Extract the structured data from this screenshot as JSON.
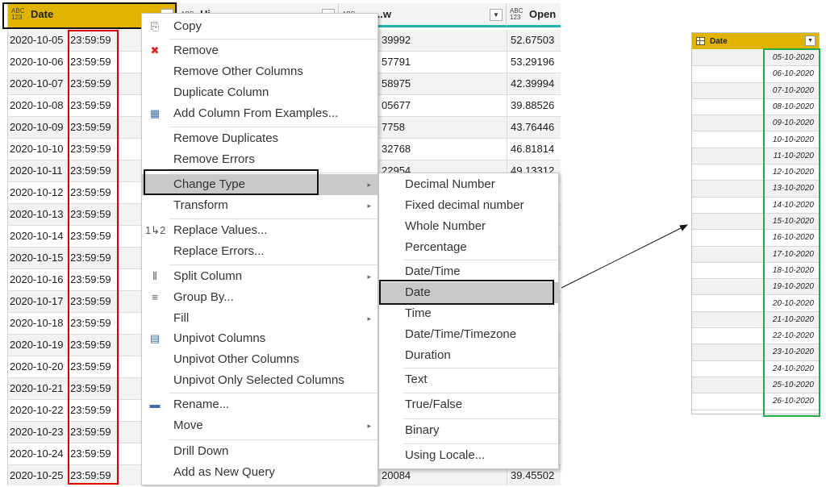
{
  "grid": {
    "columns": [
      {
        "type_icon": "ABC\n123",
        "label": "Date"
      },
      {
        "type_icon": "ABC",
        "label": "Hi..."
      },
      {
        "type_icon": "ABC",
        "label": "...w"
      },
      {
        "type_icon": "ABC\n123",
        "label": "Open"
      }
    ],
    "rows": [
      {
        "date": "2020-10-05",
        "time": "23:59:59",
        "low": "39992",
        "open": "52.67503"
      },
      {
        "date": "2020-10-06",
        "time": "23:59:59",
        "low": "57791",
        "open": "53.29196"
      },
      {
        "date": "2020-10-07",
        "time": "23:59:59",
        "low": "58975",
        "open": "42.39994"
      },
      {
        "date": "2020-10-08",
        "time": "23:59:59",
        "low": "05677",
        "open": "39.88526"
      },
      {
        "date": "2020-10-09",
        "time": "23:59:59",
        "low": "7758",
        "open": "43.76446"
      },
      {
        "date": "2020-10-10",
        "time": "23:59:59",
        "low": "32768",
        "open": "46.81814"
      },
      {
        "date": "2020-10-11",
        "time": "23:59:59",
        "low": "22954",
        "open": "49.13312"
      },
      {
        "date": "2020-10-12",
        "time": "23:59:59",
        "low": "",
        "open": ""
      },
      {
        "date": "2020-10-13",
        "time": "23:59:59",
        "low": "",
        "open": ""
      },
      {
        "date": "2020-10-14",
        "time": "23:59:59",
        "low": "",
        "open": ""
      },
      {
        "date": "2020-10-15",
        "time": "23:59:59",
        "low": "",
        "open": ""
      },
      {
        "date": "2020-10-16",
        "time": "23:59:59",
        "low": "",
        "open": ""
      },
      {
        "date": "2020-10-17",
        "time": "23:59:59",
        "low": "",
        "open": ""
      },
      {
        "date": "2020-10-18",
        "time": "23:59:59",
        "low": "",
        "open": ""
      },
      {
        "date": "2020-10-19",
        "time": "23:59:59",
        "low": "",
        "open": ""
      },
      {
        "date": "2020-10-20",
        "time": "23:59:59",
        "low": "",
        "open": ""
      },
      {
        "date": "2020-10-21",
        "time": "23:59:59",
        "low": "",
        "open": ""
      },
      {
        "date": "2020-10-22",
        "time": "23:59:59",
        "low": "",
        "open": ""
      },
      {
        "date": "2020-10-23",
        "time": "23:59:59",
        "low": "",
        "open": ""
      },
      {
        "date": "2020-10-24",
        "time": "23:59:59",
        "low": "",
        "open": ""
      },
      {
        "date": "2020-10-25",
        "time": "23:59:59",
        "low": "20084",
        "open": "39.45502"
      }
    ]
  },
  "context_menu": {
    "items": [
      {
        "label": "Copy",
        "icon": "copy-icon"
      },
      {
        "label": "Remove",
        "icon": "remove-column-icon"
      },
      {
        "label": "Remove Other Columns"
      },
      {
        "label": "Duplicate Column"
      },
      {
        "label": "Add Column From Examples...",
        "icon": "column-examples-icon"
      },
      {
        "label": "Remove Duplicates"
      },
      {
        "label": "Remove Errors"
      },
      {
        "label": "Change Type",
        "submenu": true,
        "highlighted": true
      },
      {
        "label": "Transform",
        "submenu": true
      },
      {
        "label": "Replace Values...",
        "icon": "replace-values-icon"
      },
      {
        "label": "Replace Errors..."
      },
      {
        "label": "Split Column",
        "icon": "split-column-icon",
        "submenu": true
      },
      {
        "label": "Group By...",
        "icon": "group-by-icon"
      },
      {
        "label": "Fill",
        "submenu": true
      },
      {
        "label": "Unpivot Columns",
        "icon": "unpivot-icon"
      },
      {
        "label": "Unpivot Other Columns"
      },
      {
        "label": "Unpivot Only Selected Columns"
      },
      {
        "label": "Rename...",
        "icon": "rename-icon"
      },
      {
        "label": "Move",
        "submenu": true
      },
      {
        "label": "Drill Down"
      },
      {
        "label": "Add as New Query"
      }
    ],
    "replace_icon_glyph": "1↳2"
  },
  "type_submenu": {
    "items": [
      {
        "label": "Decimal Number"
      },
      {
        "label": "Fixed decimal number"
      },
      {
        "label": "Whole Number"
      },
      {
        "label": "Percentage"
      },
      {
        "label": "Date/Time"
      },
      {
        "label": "Date",
        "highlighted": true
      },
      {
        "label": "Time"
      },
      {
        "label": "Date/Time/Timezone"
      },
      {
        "label": "Duration"
      },
      {
        "label": "Text"
      },
      {
        "label": "True/False"
      },
      {
        "label": "Binary"
      },
      {
        "label": "Using Locale..."
      }
    ]
  },
  "result": {
    "header": "Date",
    "values": [
      "05-10-2020",
      "06-10-2020",
      "07-10-2020",
      "08-10-2020",
      "09-10-2020",
      "10-10-2020",
      "11-10-2020",
      "12-10-2020",
      "13-10-2020",
      "14-10-2020",
      "15-10-2020",
      "16-10-2020",
      "17-10-2020",
      "18-10-2020",
      "19-10-2020",
      "20-10-2020",
      "21-10-2020",
      "22-10-2020",
      "23-10-2020",
      "24-10-2020",
      "25-10-2020",
      "26-10-2020"
    ]
  },
  "colors": {
    "accent_header": "#e0b400",
    "highlight_red": "#e00000",
    "highlight_green": "#22aa44",
    "column_underline": "#20b2aa"
  }
}
